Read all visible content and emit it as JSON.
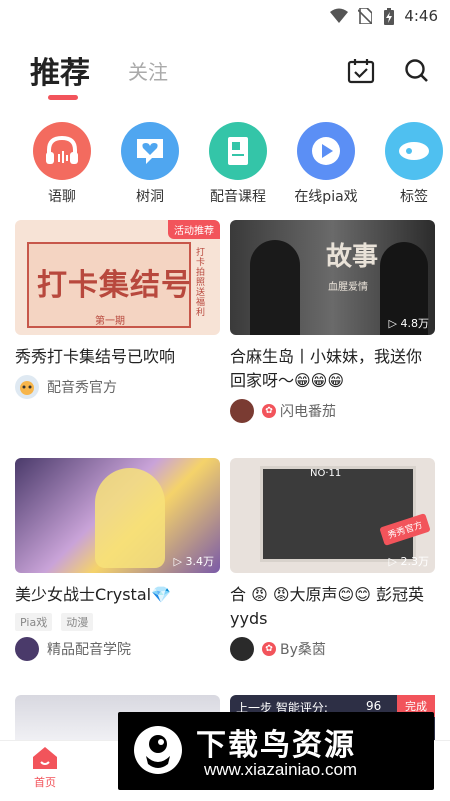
{
  "status_bar": {
    "time": "4:46"
  },
  "header": {
    "tab_recommend": "推荐",
    "tab_follow": "关注"
  },
  "categories": [
    {
      "label": "语聊",
      "color": "#f36b5f"
    },
    {
      "label": "树洞",
      "color": "#4fa6f0"
    },
    {
      "label": "配音课程",
      "color": "#34c5a8"
    },
    {
      "label": "在线pia戏",
      "color": "#5b8ff5"
    },
    {
      "label": "标签",
      "color": "#4fc0f0"
    }
  ],
  "cards": [
    {
      "title": "秀秀打卡集结号已吹响",
      "author": "配音秀官方",
      "badge": "活动推荐",
      "thumb_text": "打卡集结号",
      "thumb_sub": "第一期",
      "thumb_side": "打卡拍照送福利"
    },
    {
      "title": "合麻生岛丨小妹妹，我送你回家呀～😁😁😁",
      "prefix": "合",
      "author": "闪电番茄",
      "plays": "4.8万",
      "thumb_text": "故事",
      "thumb_sub": "血腥爱情"
    },
    {
      "title": "美少女战士Crystal💎",
      "author": "精品配音学院",
      "plays": "3.4万",
      "tags": [
        "Pia戏",
        "动漫"
      ]
    },
    {
      "title": "合 😡 😡大原声😊😊 彭冠英yyds",
      "author": "By桑茵",
      "plays": "2.3万",
      "badge": "秀秀官方",
      "thumb_no": "NO·11"
    }
  ],
  "partial_card": {
    "text": "上一步 智能评分:",
    "score": "96",
    "done": "完成"
  },
  "bottom_nav": {
    "home": "首页"
  },
  "watermark": {
    "cn": "下载鸟资源",
    "url": "www.xiazainiao.com"
  }
}
